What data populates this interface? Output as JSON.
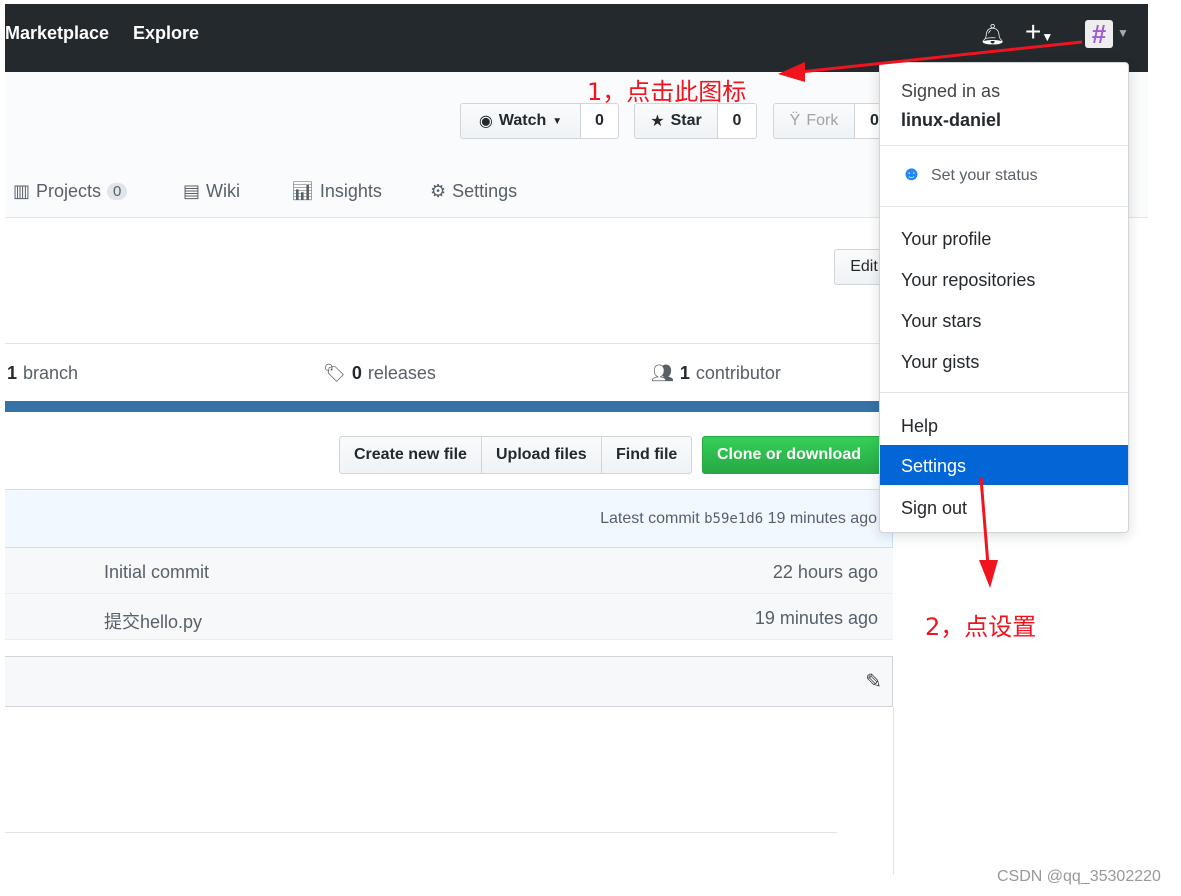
{
  "nav": {
    "links": [
      "Marketplace",
      "Explore"
    ],
    "avatar_color": "#a05ad8"
  },
  "repo_actions": {
    "watch": "Watch",
    "watch_count": "0",
    "star": "Star",
    "star_count": "0",
    "fork": "Fork",
    "fork_count": "0"
  },
  "tabs": [
    {
      "label": "Projects",
      "count": "0"
    },
    {
      "label": "Wiki"
    },
    {
      "label": "Insights"
    },
    {
      "label": "Settings"
    }
  ],
  "edit_label": "Edit",
  "stats": {
    "branch_num": "1",
    "branch": "branch",
    "release_num": "0",
    "release": "releases",
    "contrib_num": "1",
    "contrib": "contributor"
  },
  "language_bar_color": "#3572A5",
  "file_buttons": [
    "Create new file",
    "Upload files",
    "Find file",
    "Clone or download"
  ],
  "latest_commit": {
    "label": "Latest commit",
    "sha": "b59e1d6",
    "time": "19 minutes ago"
  },
  "files": [
    {
      "message": "Initial commit",
      "time": "22 hours ago"
    },
    {
      "message": "提交hello.py",
      "time": "19 minutes ago"
    }
  ],
  "dropdown": {
    "signed_in": "Signed in as",
    "username": "linux-daniel",
    "status": "Set your status",
    "items1": [
      "Your profile",
      "Your repositories",
      "Your stars",
      "Your gists"
    ],
    "help": "Help",
    "settings": "Settings",
    "signout": "Sign out"
  },
  "annotations": {
    "step1": "1，点击此图标",
    "step2": "2，点设置"
  },
  "watermark": "CSDN @qq_35302220"
}
